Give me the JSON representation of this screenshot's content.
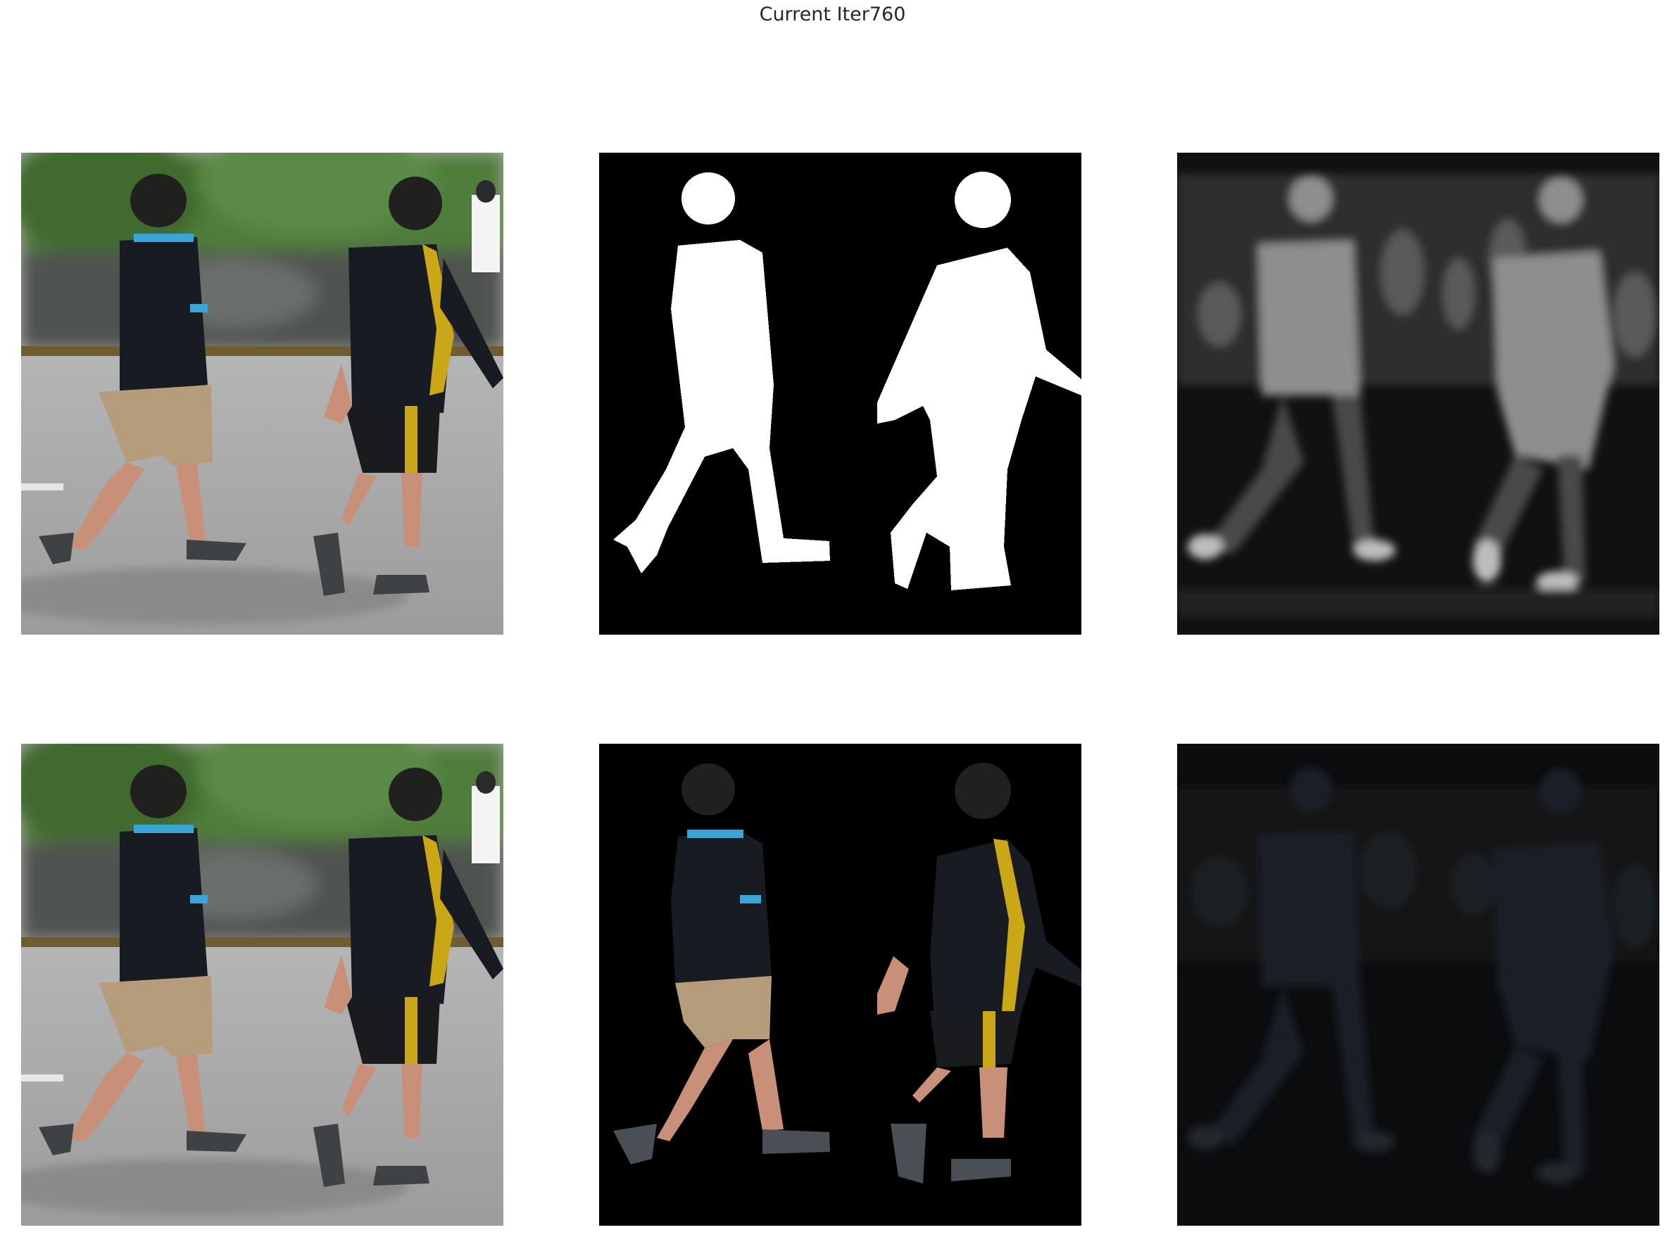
{
  "figure": {
    "title": "Current Iter760"
  },
  "panels": [
    {
      "row": 0,
      "col": 0,
      "content": "input-photo-icon"
    },
    {
      "row": 0,
      "col": 1,
      "content": "ground-truth-mask-icon"
    },
    {
      "row": 0,
      "col": 2,
      "content": "predicted-map-icon"
    },
    {
      "row": 1,
      "col": 0,
      "content": "input-photo-icon"
    },
    {
      "row": 1,
      "col": 1,
      "content": "masked-photo-icon"
    },
    {
      "row": 1,
      "col": 2,
      "content": "predicted-masked-photo-icon"
    }
  ],
  "colors": {
    "background": "#ffffff",
    "title_text": "#262626",
    "mask_fg": "#ffffff",
    "mask_bg": "#000000",
    "shirt": "#181c22",
    "shirt_accent_blue": "#3aa6d8",
    "shirt_accent_yellow": "#c9a717",
    "shorts_khaki": "#b59c7a",
    "road": "#a6a6a6",
    "foliage": "#4d7a3a",
    "skin": "#c99079"
  }
}
